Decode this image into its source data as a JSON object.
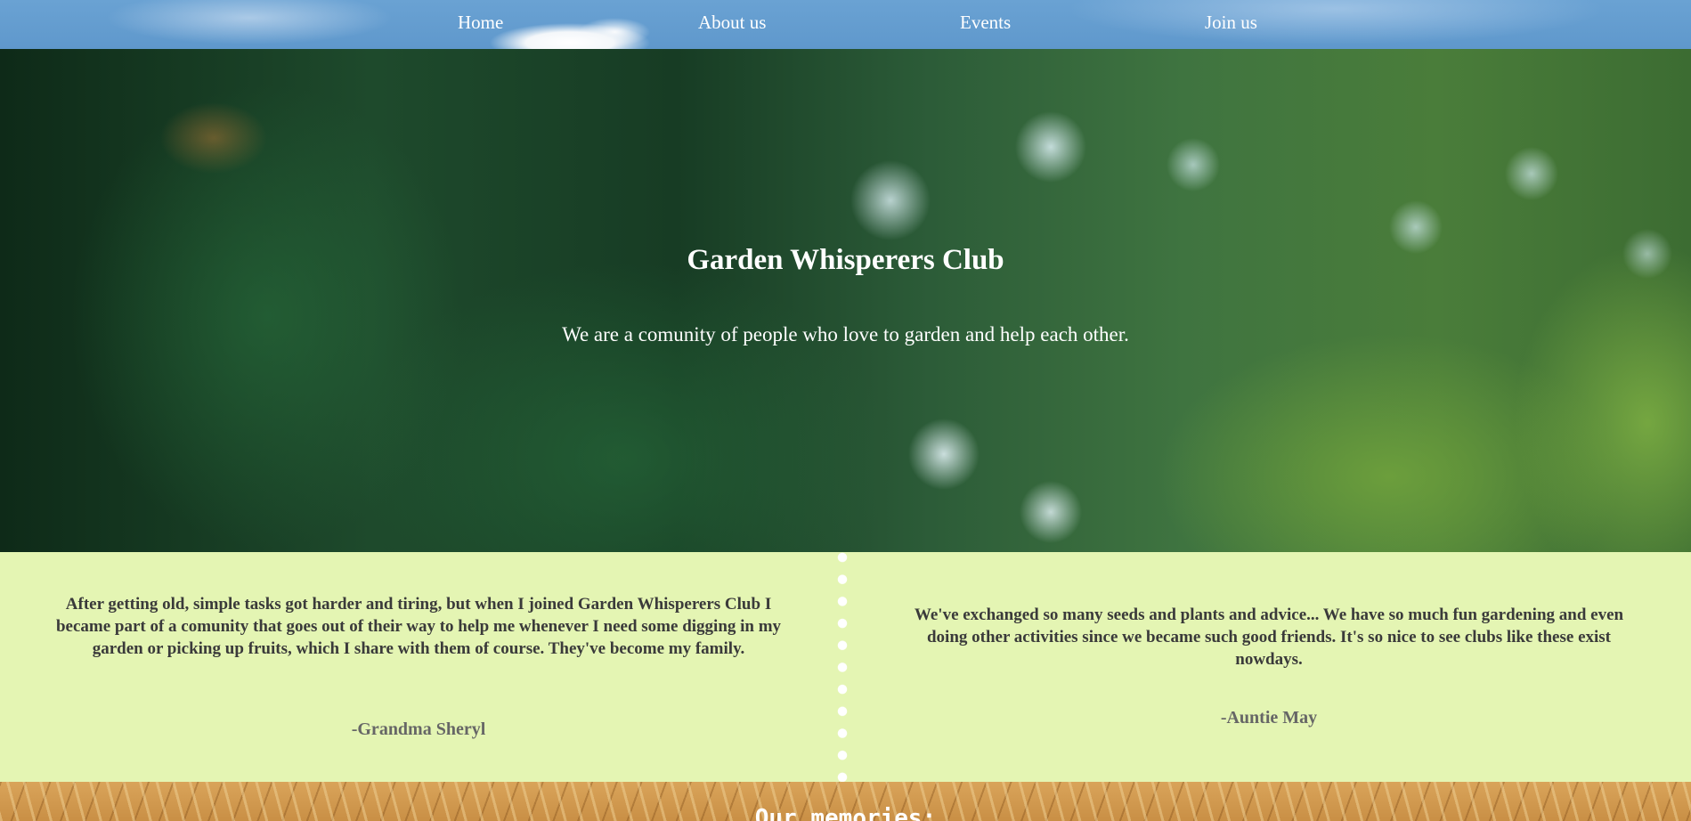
{
  "nav": {
    "items": [
      {
        "label": "Home"
      },
      {
        "label": "About us"
      },
      {
        "label": "Events"
      },
      {
        "label": "Join us"
      }
    ]
  },
  "hero": {
    "title": "Garden Whisperers Club",
    "subtitle": "We are a comunity of people who love to garden and help each other."
  },
  "testimonials": [
    {
      "quote": "After getting old, simple tasks got harder and tiring, but when I joined Garden Whisperers Club I became part of a comunity that goes out of their way to help me whenever I need some digging in my garden or picking up fruits, which I share with them of course. They've become my family.",
      "author": "-Grandma Sheryl"
    },
    {
      "quote": "We've exchanged so many seeds and plants and advice... We have so much fun gardening and even doing other activities since we became such good friends. It's so nice to see clubs like these exist nowdays.",
      "author": "-Auntie May"
    }
  ],
  "memories": {
    "title": "Our memories:"
  },
  "colors": {
    "testimonial_bg": "#e4f5b3",
    "nav_sky": "#6aa2d3",
    "text_dark": "#3a3a3a",
    "author_gray": "#666666"
  }
}
